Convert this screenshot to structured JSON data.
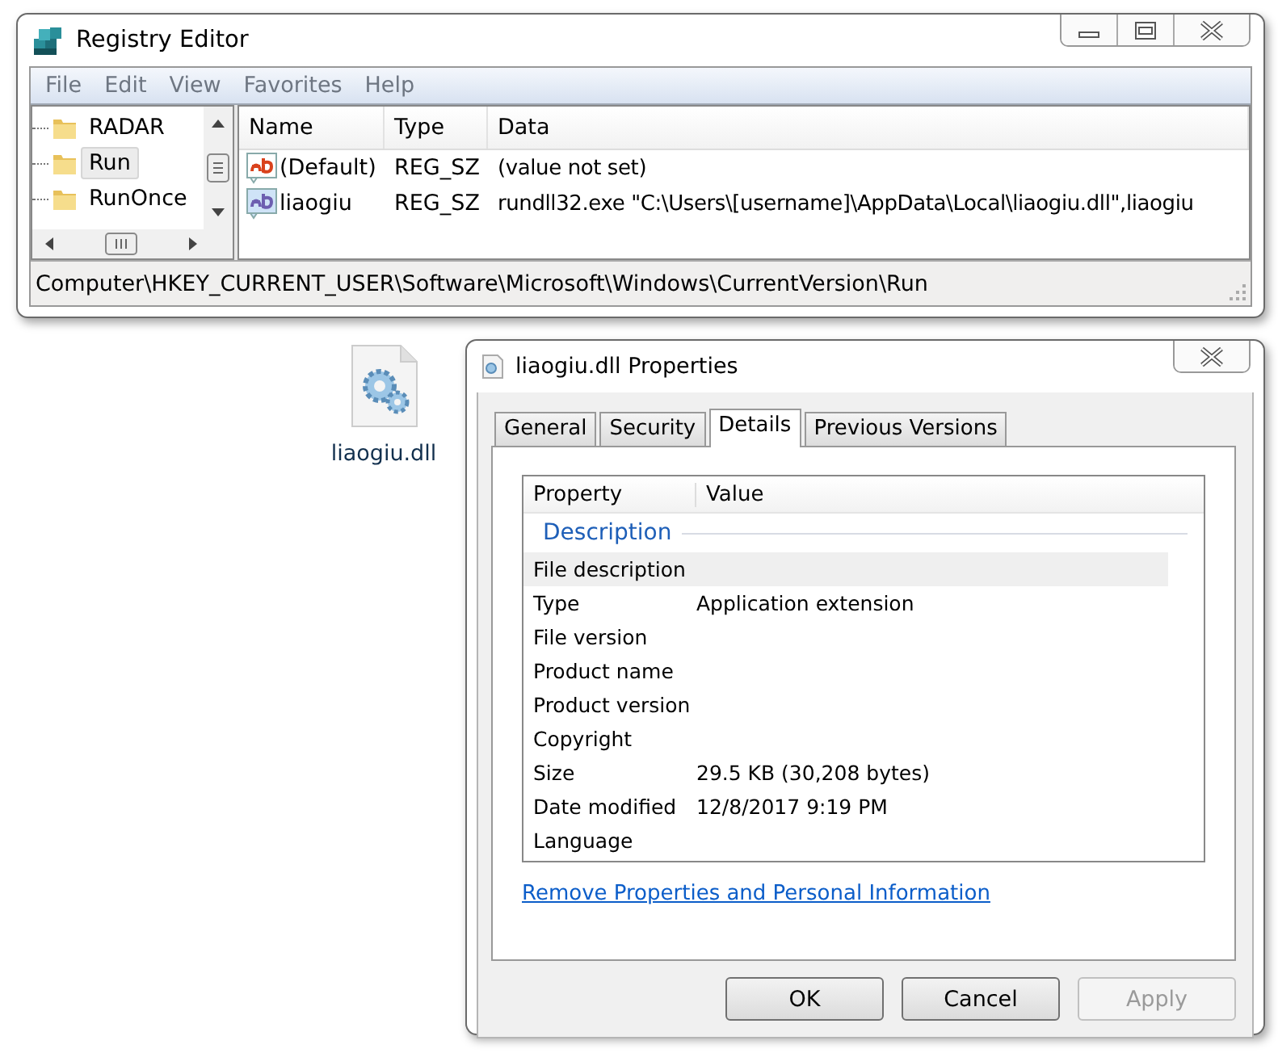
{
  "registry_editor": {
    "title": "Registry Editor",
    "menu": [
      "File",
      "Edit",
      "View",
      "Favorites",
      "Help"
    ],
    "tree": [
      {
        "label": "RADAR",
        "selected": false
      },
      {
        "label": "Run",
        "selected": true
      },
      {
        "label": "RunOnce",
        "selected": false
      }
    ],
    "columns": [
      "Name",
      "Type",
      "Data"
    ],
    "values": [
      {
        "name": "(Default)",
        "type": "REG_SZ",
        "data": "(value not set)",
        "kind": "default"
      },
      {
        "name": "liaogiu",
        "type": "REG_SZ",
        "data": "rundll32.exe \"C:\\Users\\[username]\\AppData\\Local\\liaogiu.dll\",liaogiu",
        "kind": "custom"
      }
    ],
    "status_bar": "Computer\\HKEY_CURRENT_USER\\Software\\Microsoft\\Windows\\CurrentVersion\\Run"
  },
  "desktop_file": {
    "label": "liaogiu.dll"
  },
  "properties": {
    "title": "liaogiu.dll Properties",
    "tabs": [
      {
        "label": "General",
        "selected": false
      },
      {
        "label": "Security",
        "selected": false
      },
      {
        "label": "Details",
        "selected": true
      },
      {
        "label": "Previous Versions",
        "selected": false
      }
    ],
    "columns": [
      "Property",
      "Value"
    ],
    "section": "Description",
    "rows": [
      {
        "property": "File description",
        "selected": true
      },
      {
        "property": "Type",
        "value": "Application extension",
        "selected": false
      },
      {
        "property": "File version",
        "selected": false
      },
      {
        "property": "Product name",
        "selected": false
      },
      {
        "property": "Product version",
        "selected": false
      },
      {
        "property": "Copyright",
        "selected": false
      },
      {
        "property": "Size",
        "value": "29.5 KB (30,208 bytes)",
        "selected": false
      },
      {
        "property": "Date modified",
        "value": "12/8/2017 9:19 PM",
        "selected": false
      },
      {
        "property": "Language",
        "selected": false
      }
    ],
    "link": "Remove Properties and Personal Information",
    "buttons": [
      {
        "label": "OK",
        "disabled": false
      },
      {
        "label": "Cancel",
        "disabled": false
      },
      {
        "label": "Apply",
        "disabled": true
      }
    ]
  }
}
